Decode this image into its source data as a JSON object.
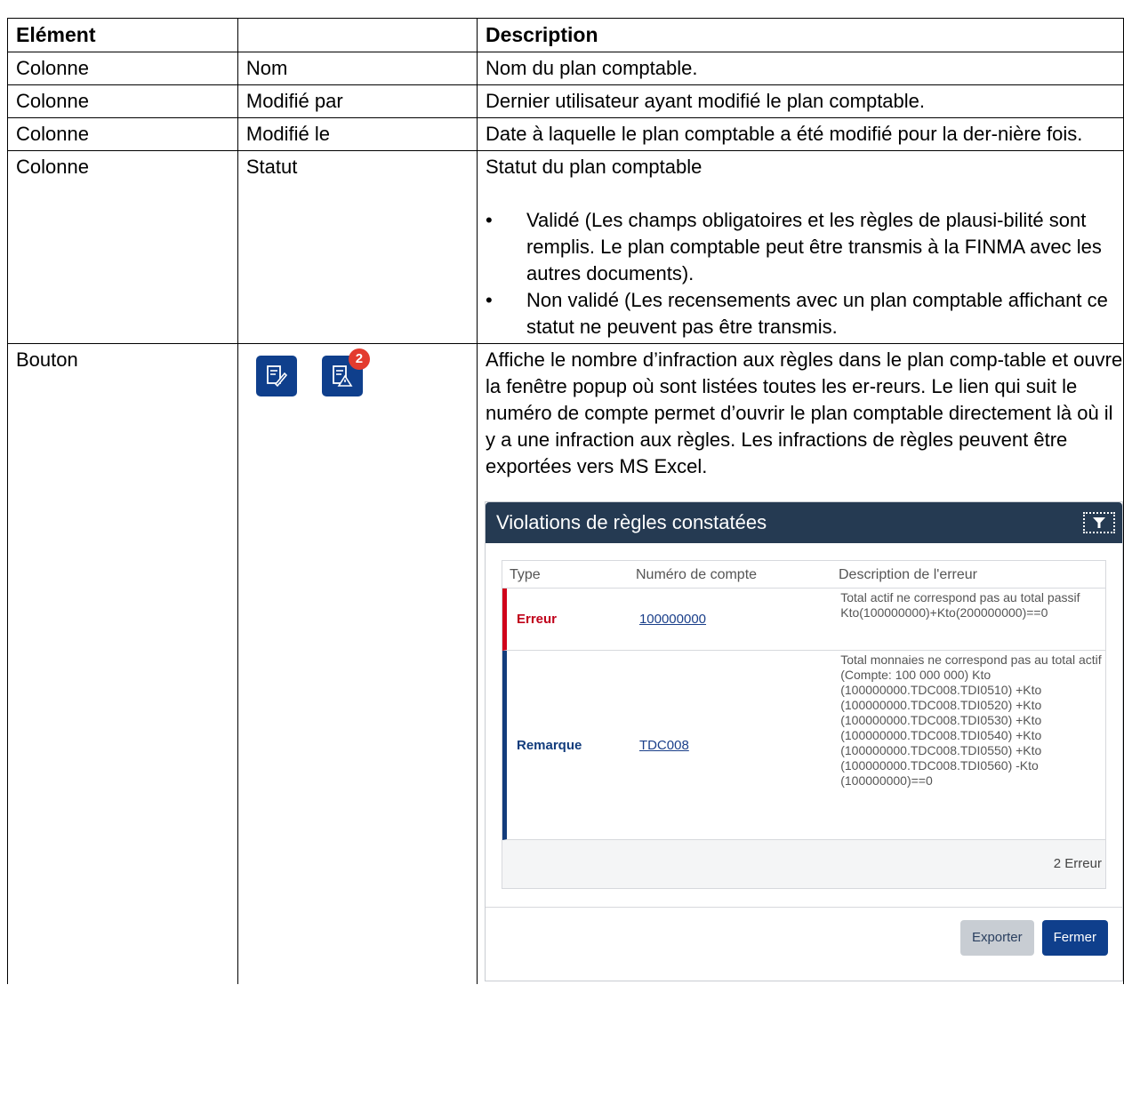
{
  "table": {
    "headers": [
      "Elément",
      "",
      "Description"
    ],
    "rows": [
      {
        "element": "Colonne",
        "name": "Nom",
        "description": "Nom du plan comptable."
      },
      {
        "element": "Colonne",
        "name": "Modifié par",
        "description": "Dernier utilisateur ayant modifié le plan comptable."
      },
      {
        "element": "Colonne",
        "name": "Modifié le",
        "description": "Date à laquelle le plan comptable a été modifié pour la der-nière fois."
      },
      {
        "element": "Colonne",
        "name": "Statut",
        "description": "Statut du plan comptable",
        "bullets": [
          "Validé (Les champs obligatoires et les règles de plausi-bilité sont remplis. Le plan comptable peut être transmis à la FINMA avec les autres documents).",
          "Non validé (Les recensements avec un plan comptable affichant ce statut ne peuvent pas être transmis."
        ]
      },
      {
        "element": "Bouton",
        "name": "",
        "description": "Affiche le nombre d’infraction aux règles dans le plan comp-table et ouvre la fenêtre popup où sont listées toutes les er-reurs. Le lien qui suit le numéro de compte permet d’ouvrir le plan comptable directement là où il y a une infraction aux règles. Les infractions de règles peuvent être exportées vers MS Excel.",
        "icons": [
          "rules-check-icon",
          "rules-violations-icon"
        ],
        "badge": "2"
      }
    ]
  },
  "popup": {
    "title": "Violations de règles constatées",
    "filter_icon": "filter-icon",
    "columns": [
      "Type",
      "Numéro de compte",
      "Description de l'erreur"
    ],
    "rows": [
      {
        "type": "Erreur",
        "account": "100000000",
        "description": "Total actif ne correspond pas au total passif Kto(100000000)+Kto(200000000)==0"
      },
      {
        "type": "Remarque",
        "account": "TDC008",
        "description": "Total monnaies ne correspond pas au total actif (Compte: 100 000 000) Kto (100000000.TDC008.TDI0510) +Kto (100000000.TDC008.TDI0520) +Kto (100000000.TDC008.TDI0530) +Kto (100000000.TDC008.TDI0540) +Kto (100000000.TDC008.TDI0550) +Kto (100000000.TDC008.TDI0560) -Kto (100000000)==0"
      }
    ],
    "footer_count": "2 Erreur",
    "export_label": "Exporter",
    "close_label": "Fermer"
  },
  "colors": {
    "primary": "#0f3f8c",
    "header": "#253a52",
    "error": "#d0021b",
    "remark": "#123c7c",
    "badge": "#e33b2e"
  }
}
